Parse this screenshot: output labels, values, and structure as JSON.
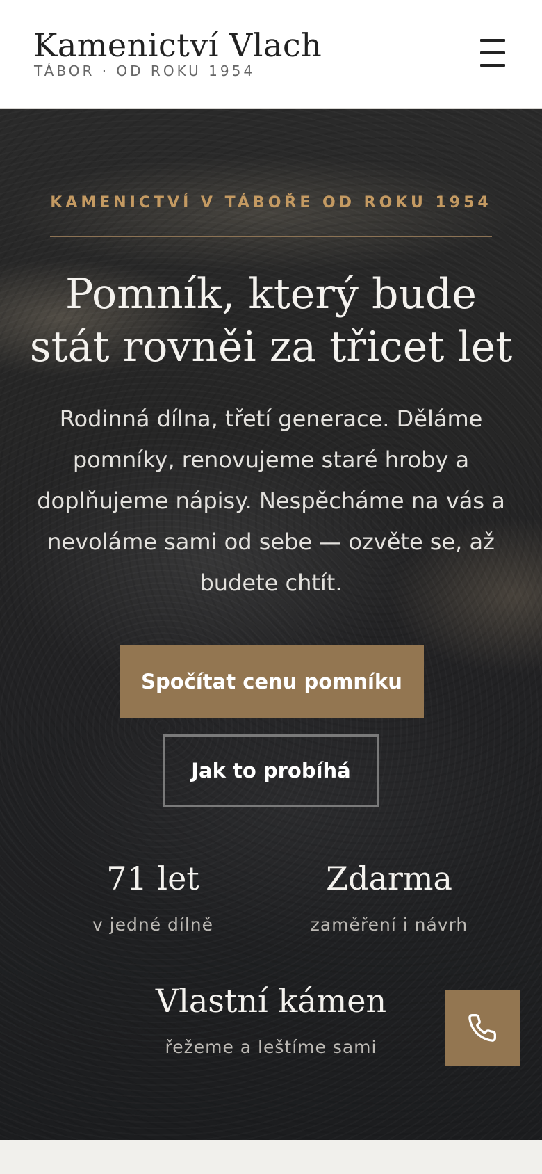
{
  "header": {
    "brand_name": "Kamenictví Vlach",
    "brand_tagline": "TÁBOR · OD ROKU 1954",
    "menu_icon": "hamburger-menu-icon"
  },
  "hero": {
    "eyebrow": "KAMENICTVÍ V TÁBOŘE OD ROKU 1954",
    "title": "Pomník, který bude stát rovněi za třicet let",
    "text": "Rodinná dílna, třetí generace. Děláme pomníky, renovujeme staré hroby a doplňujeme nápisy. Nespěcháme na vás a nevoláme sami od sebe — ozvěte se, až budete chtít.",
    "primary_button": "Spočítat cenu pomníku",
    "secondary_button": "Jak to probíhá"
  },
  "stats": [
    {
      "value": "71 let",
      "label": "v jedné dílně"
    },
    {
      "value": "Zdarma",
      "label": "zaměření i návrh"
    },
    {
      "value": "Vlastní kámen",
      "label": "řežeme a leštíme sami"
    }
  ],
  "floating_call": {
    "icon": "phone-icon"
  },
  "colors": {
    "accent": "#937651",
    "eyebrow": "#c49a62",
    "hero_bg": "#1f2022",
    "header_bg": "#ffffff",
    "page_bg": "#f1f0ec"
  }
}
